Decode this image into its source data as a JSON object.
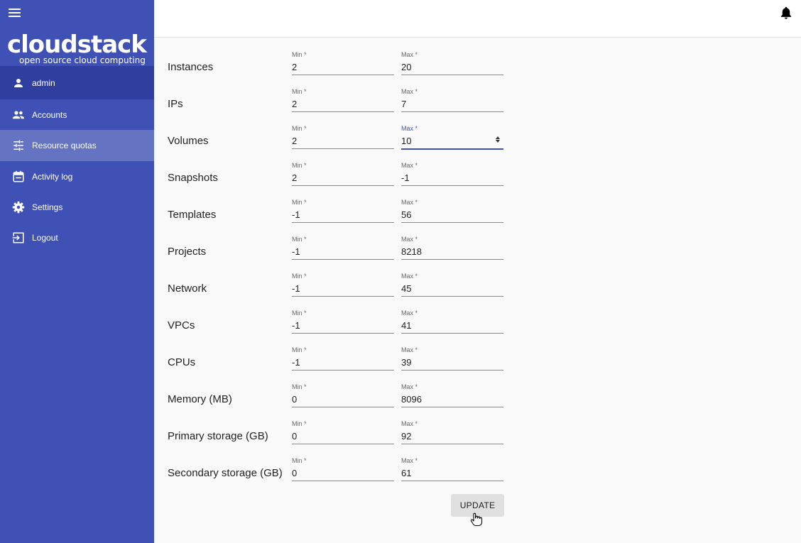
{
  "colors": {
    "sidebar": "#3f51b5",
    "sidebar_dark": "#303f9f",
    "active_item": "#6573c3",
    "focus": "#3f51b5"
  },
  "logo": {
    "main": "cloudstack",
    "sub": "open source cloud computing"
  },
  "user": {
    "name": "admin",
    "icon": "person-icon"
  },
  "nav": [
    {
      "label": "Accounts",
      "icon": "accounts-icon"
    },
    {
      "label": "Resource quotas",
      "icon": "tune-icon",
      "active": true
    },
    {
      "label": "Activity log",
      "icon": "calendar-icon"
    },
    {
      "label": "Settings",
      "icon": "gear-icon"
    },
    {
      "label": "Logout",
      "icon": "logout-icon"
    }
  ],
  "form": {
    "min_label": "Min *",
    "max_label": "Max *",
    "rows": [
      {
        "label": "Instances",
        "min": "2",
        "max": "20"
      },
      {
        "label": "IPs",
        "min": "2",
        "max": "7"
      },
      {
        "label": "Volumes",
        "min": "2",
        "max": "10",
        "max_focused": true
      },
      {
        "label": "Snapshots",
        "min": "2",
        "max": "-1"
      },
      {
        "label": "Templates",
        "min": "-1",
        "max": "56"
      },
      {
        "label": "Projects",
        "min": "-1",
        "max": "8218"
      },
      {
        "label": "Network",
        "min": "-1",
        "max": "45"
      },
      {
        "label": "VPCs",
        "min": "-1",
        "max": "41"
      },
      {
        "label": "CPUs",
        "min": "-1",
        "max": "39"
      },
      {
        "label": "Memory (MB)",
        "min": "0",
        "max": "8096"
      },
      {
        "label": "Primary storage (GB)",
        "min": "0",
        "max": "92"
      },
      {
        "label": "Secondary storage (GB)",
        "min": "0",
        "max": "61"
      }
    ],
    "update_label": "UPDATE"
  }
}
